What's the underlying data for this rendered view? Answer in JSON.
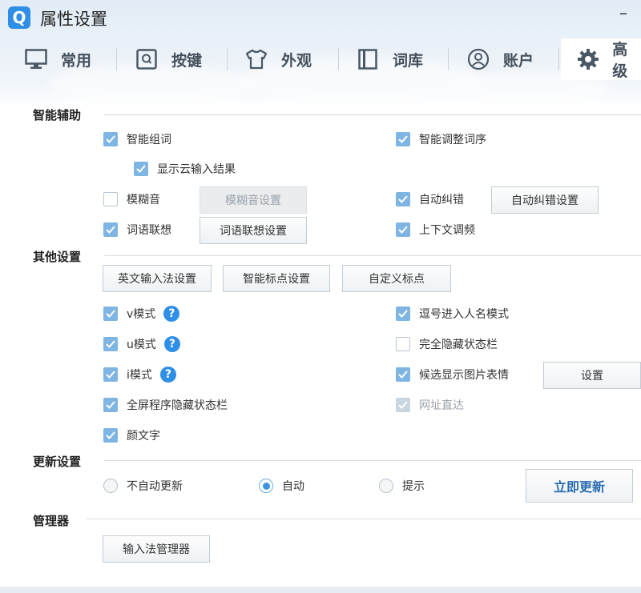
{
  "window": {
    "logo_text": "Q",
    "title": "属性设置",
    "minimize_label": "–"
  },
  "tabs": [
    {
      "label": "常用",
      "icon": "monitor-icon"
    },
    {
      "label": "按键",
      "icon": "key-icon"
    },
    {
      "label": "外观",
      "icon": "shirt-icon"
    },
    {
      "label": "词库",
      "icon": "book-icon"
    },
    {
      "label": "账户",
      "icon": "user-icon"
    },
    {
      "label": "高级",
      "icon": "gear-icon",
      "active": true
    }
  ],
  "smart_assist": {
    "title": "智能辅助",
    "smart_phrase": {
      "label": "智能组词",
      "checked": true
    },
    "smart_order": {
      "label": "智能调整词序",
      "checked": true
    },
    "cloud_result": {
      "label": "显示云输入结果",
      "checked": true
    },
    "fuzzy": {
      "label": "模糊音",
      "checked": false
    },
    "fuzzy_settings": "模糊音设置",
    "auto_correct": {
      "label": "自动纠错",
      "checked": true
    },
    "auto_correct_settings": "自动纠错设置",
    "word_assoc": {
      "label": "词语联想",
      "checked": true
    },
    "word_assoc_settings": "词语联想设置",
    "context_adjust": {
      "label": "上下文调频",
      "checked": true
    }
  },
  "other": {
    "title": "其他设置",
    "english_ime_settings": "英文输入法设置",
    "smart_punct_settings": "智能标点设置",
    "custom_punct": "自定义标点",
    "v_mode": {
      "label": "v模式",
      "checked": true
    },
    "comma_name_mode": {
      "label": "逗号进入人名模式",
      "checked": true
    },
    "u_mode": {
      "label": "u模式",
      "checked": true
    },
    "hide_status_bar": {
      "label": "完全隐藏状态栏",
      "checked": false
    },
    "i_mode": {
      "label": "i模式",
      "checked": true
    },
    "candidate_image": {
      "label": "候选显示图片表情",
      "checked": true
    },
    "candidate_image_settings": "设置",
    "fullscreen_hide": {
      "label": "全屏程序隐藏状态栏",
      "checked": true
    },
    "url_direct": {
      "label": "网址直达",
      "checked": true,
      "disabled": true
    },
    "kaomoji": {
      "label": "颜文字",
      "checked": true
    },
    "help_glyph": "?"
  },
  "update": {
    "title": "更新设置",
    "options": [
      {
        "label": "不自动更新",
        "selected": false
      },
      {
        "label": "自动",
        "selected": true
      },
      {
        "label": "提示",
        "selected": false
      }
    ],
    "update_now": "立即更新"
  },
  "manager": {
    "title": "管理器",
    "ime_manager": "输入法管理器"
  },
  "colors": {
    "accent": "#2f8fe6",
    "checkbox_checked": "#7fb5e3"
  }
}
